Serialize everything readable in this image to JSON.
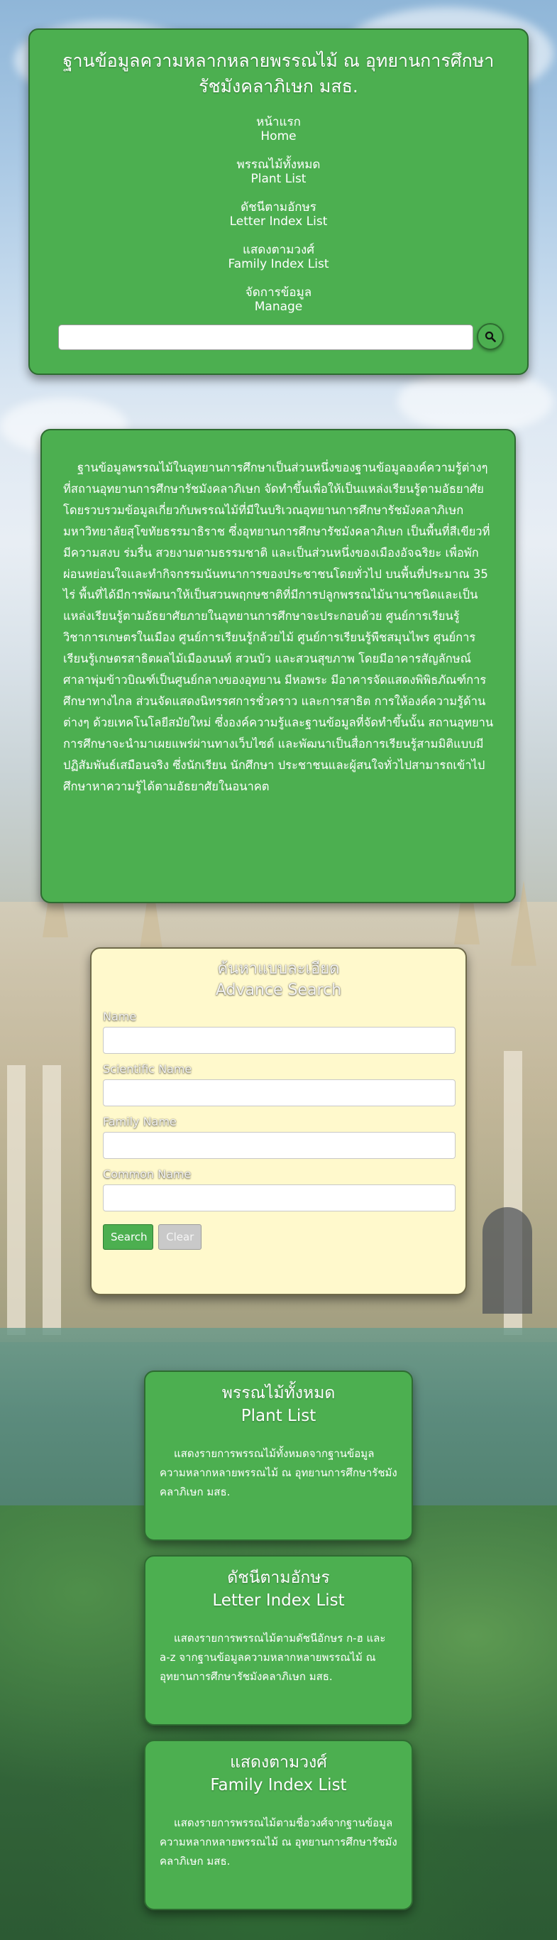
{
  "header": {
    "title": "ฐานข้อมูลความหลากหลายพรรณไม้ ณ อุทยานการศึกษารัชมังคลาภิเษก มสธ.",
    "nav": [
      {
        "thai": "หน้าแรก",
        "en": "Home"
      },
      {
        "thai": "พรรณไม้ทั้งหมด",
        "en": "Plant List"
      },
      {
        "thai": "ดัชนีตามอักษร",
        "en": "Letter Index List"
      },
      {
        "thai": "แสดงตามวงศ์",
        "en": "Family Index List"
      },
      {
        "thai": "จัดการข้อมูล",
        "en": "Manage"
      }
    ],
    "search": {
      "value": "",
      "placeholder": ""
    },
    "search_icon": "magnifier-icon"
  },
  "intro": {
    "text": "ฐานข้อมูลพรรณไม้ในอุทยานการศึกษาเป็นส่วนหนึ่งของฐานข้อมูลองค์ความรู้ต่างๆ ที่สถานอุทยานการศึกษารัชมังคลาภิเษก จัดทำขึ้นเพื่อให้เป็นแหล่งเรียนรู้ตามอัธยาศัย โดยรวบรวมข้อมูลเกี่ยวกับพรรณไม้ที่มีในบริเวณอุทยานการศึกษารัชมังคลาภิเษก มหาวิทยาลัยสุโขทัยธรรมาธิราช ซึ่งอุทยานการศึกษารัชมังคลาภิเษก เป็นพื้นที่สีเขียวที่มีความสงบ ร่มรื่น สวยงามตามธรรมชาติ และเป็นส่วนหนึ่งของเมืองอัจฉริยะ เพื่อพักผ่อนหย่อนใจและทำกิจกรรมนันทนาการของประชาชนโดยทั่วไป บนพื้นที่ประมาณ 35 ไร่ พื้นที่ได้มีการพัฒนาให้เป็นสวนพฤกษชาติที่มีการปลูกพรรณไม้นานาชนิดและเป็นแหล่งเรียนรู้ตามอัธยาศัยภายในอุทยานการศึกษาจะประกอบด้วย ศูนย์การเรียนรู้วิชาการเกษตรในเมือง ศูนย์การเรียนรู้กล้วยไม้ ศูนย์การเรียนรู้พืชสมุนไพร ศูนย์การเรียนรู้เกษตรสาธิตผลไม้เมืองนนท์ สวนบัว และสวนสุขภาพ โดยมีอาคารสัญลักษณ์ศาลาพุ่มข้าวบิณฑ์เป็นศูนย์กลางของอุทยาน มีหอพระ มีอาคารจัดแสดงพิพิธภัณฑ์การศึกษาทางไกล ส่วนจัดแสดงนิทรรศการชั่วคราว และการสาธิต การให้องค์ความรู้ด้านต่างๆ ด้วยเทคโนโลยีสมัยใหม่ ซึ่งองค์ความรู้และฐานข้อมูลที่จัดทำขึ้นนั้น สถานอุทยานการศึกษาจะนำมาเผยแพร่ผ่านทางเว็บไซต์ และพัฒนาเป็นสื่อการเรียนรู้สามมิติแบบมีปฏิสัมพันธ์เสมือนจริง ซึ่งนักเรียน นักศึกษา ประชาชนและผู้สนใจทั่วไปสามารถเข้าไปศึกษาหาความรู้ได้ตามอัธยาศัยในอนาคต"
  },
  "advance_search": {
    "title_thai": "ค้นหาแบบละเอียด",
    "title_en": "Advance Search",
    "fields": [
      {
        "label": "Name",
        "value": ""
      },
      {
        "label": "Scientific Name",
        "value": ""
      },
      {
        "label": "Family Name",
        "value": ""
      },
      {
        "label": "Common Name",
        "value": ""
      }
    ],
    "search_label": "Search",
    "clear_label": "Clear"
  },
  "cards": [
    {
      "title_thai": "พรรณไม้ทั้งหมด",
      "title_en": "Plant List",
      "desc": "แสดงรายการพรรณไม้ทั้งหมดจากฐานข้อมูลความหลากหลายพรรณไม้ ณ อุทยานการศึกษารัชมังคลาภิเษก มสธ."
    },
    {
      "title_thai": "ดัชนีตามอักษร",
      "title_en": "Letter Index List",
      "desc": "แสดงรายการพรรณไม้ตามดัชนีอักษร ก-ฮ และ a-z จากฐานข้อมูลความหลากหลายพรรณไม้ ณ อุทยานการศึกษารัชมังคลาภิเษก มสธ."
    },
    {
      "title_thai": "แสดงตามวงศ์",
      "title_en": "Family Index List",
      "desc": "แสดงรายการพรรณไม้ตามชื่อวงศ์จากฐานข้อมูลความหลากหลายพรรณไม้ ณ อุทยานการศึกษารัชมังคลาภิเษก มสธ."
    }
  ],
  "colors": {
    "card_green": "#4caf50",
    "card_border": "#2e6b31",
    "adv_bg": "#fff9cc"
  }
}
